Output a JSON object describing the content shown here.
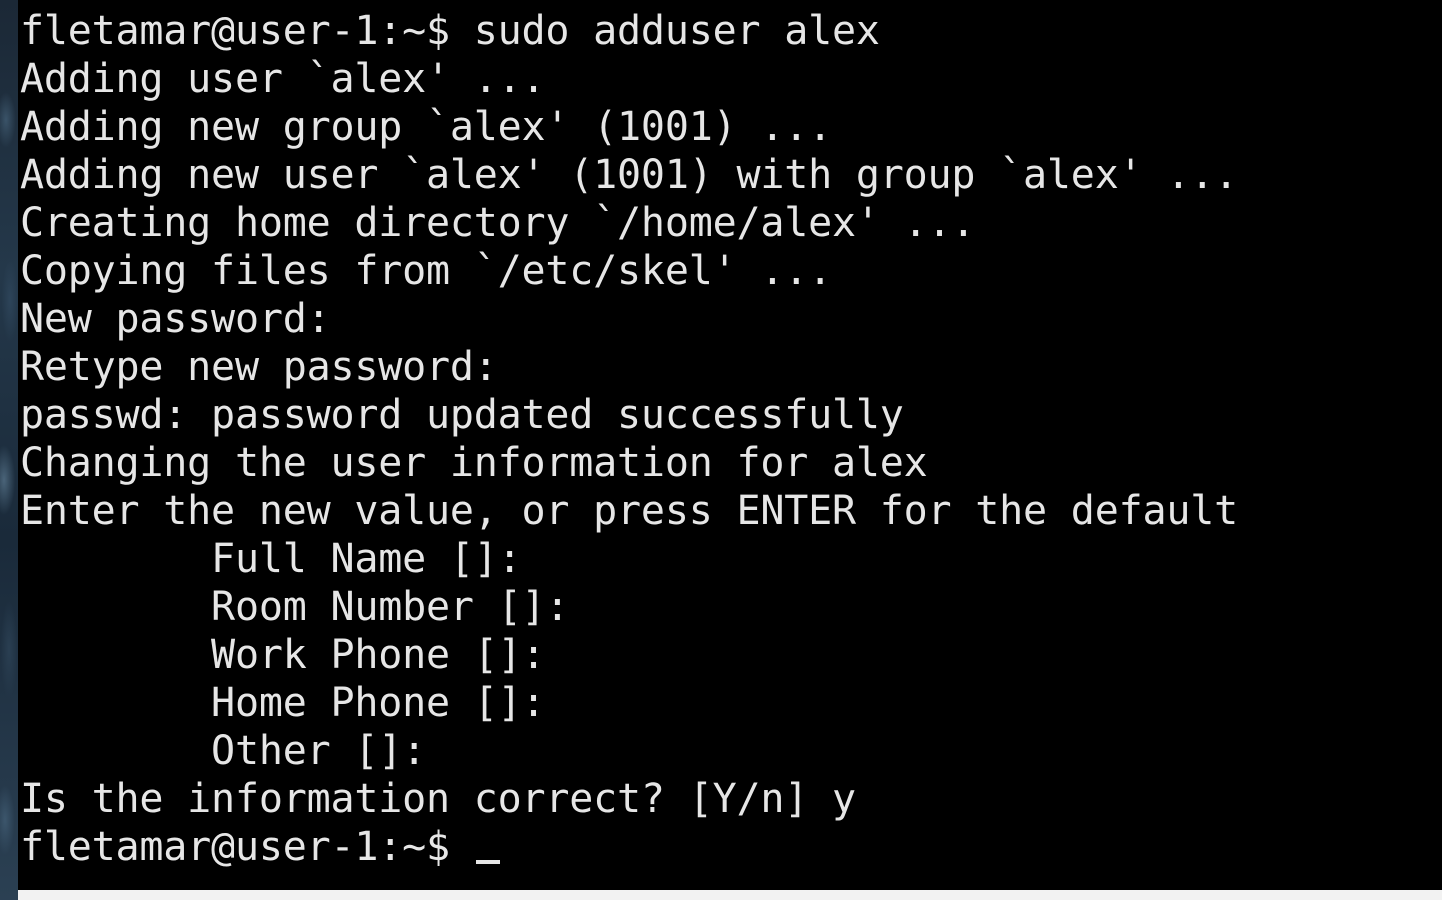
{
  "terminal": {
    "lines": [
      "fletamar@user-1:~$ sudo adduser alex",
      "Adding user `alex' ...",
      "Adding new group `alex' (1001) ...",
      "Adding new user `alex' (1001) with group `alex' ...",
      "Creating home directory `/home/alex' ...",
      "Copying files from `/etc/skel' ...",
      "New password:",
      "Retype new password:",
      "passwd: password updated successfully",
      "Changing the user information for alex",
      "Enter the new value, or press ENTER for the default",
      "        Full Name []:",
      "        Room Number []:",
      "        Work Phone []:",
      "        Home Phone []:",
      "        Other []:",
      "Is the information correct? [Y/n] y",
      "fletamar@user-1:~$ "
    ],
    "colors": {
      "background": "#000000",
      "foreground": "#e6e6e6"
    }
  }
}
